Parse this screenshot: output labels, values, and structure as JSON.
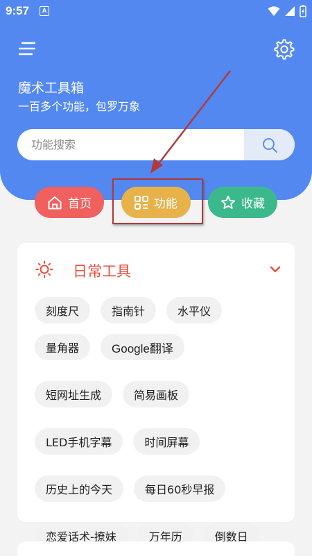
{
  "statusbar": {
    "time": "9:57",
    "notification_badge": "A"
  },
  "header": {
    "title": "魔术工具箱",
    "subtitle": "一百多个功能，包罗万象",
    "background_color": "#5388f0"
  },
  "search": {
    "placeholder": "功能搜索",
    "value": ""
  },
  "nav": [
    {
      "label": "首页",
      "icon": "home-icon",
      "color": "#f0605e"
    },
    {
      "label": "功能",
      "icon": "grid-icon",
      "color": "#e8b24b"
    },
    {
      "label": "收藏",
      "icon": "star-icon",
      "color": "#3cb98c"
    }
  ],
  "section": {
    "title": "日常工具",
    "icon": "sun-icon",
    "accent_color": "#e84c3d",
    "tools": [
      "刻度尺",
      "指南针",
      "水平仪",
      "量角器",
      "Google翻译",
      "短网址生成",
      "简易画板",
      "LED手机字幕",
      "时间屏幕",
      "历史上的今天",
      "每日60秒早报",
      "恋爱话术-撩妹",
      "万年历",
      "倒数日"
    ]
  }
}
